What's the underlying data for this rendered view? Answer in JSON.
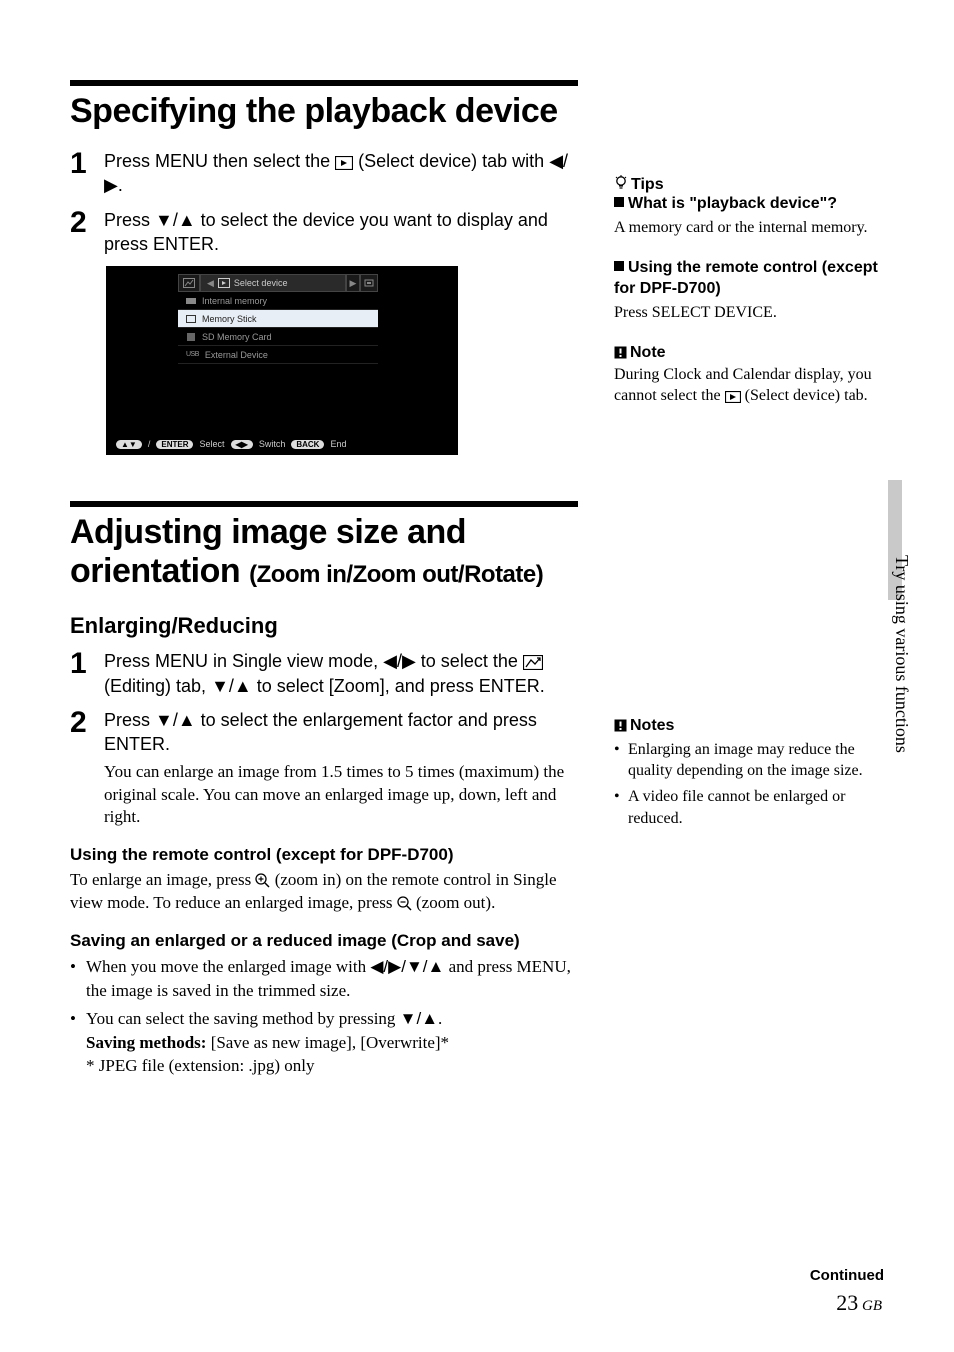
{
  "title1": "Specifying the playback device",
  "spec_steps": {
    "s1": {
      "num": "1",
      "text_a": "Press MENU then select the ",
      "text_b": " (Select device) tab with ",
      "arrows1": "B/b",
      "text_c": "."
    },
    "s2": {
      "num": "2",
      "text": "Press v/V to select the device you want to display and press ENTER."
    }
  },
  "screenshot": {
    "tab_label": "Select device",
    "items": [
      "Internal memory",
      "Memory Stick",
      "SD Memory Card",
      "External Device"
    ],
    "usb_prefix": "USB",
    "footer": {
      "enter": "ENTER",
      "select": "Select",
      "switch": "Switch",
      "back": "BACK",
      "end": "End"
    }
  },
  "title2_a": "Adjusting image size and orientation",
  "title2_b": "(Zoom in/Zoom out/Rotate)",
  "sect_enlarge": "Enlarging/Reducing",
  "enlarge_steps": {
    "s1": {
      "num": "1",
      "t1": "Press MENU in Single view mode, ",
      "ar1": "B/b",
      "t2": " to select the ",
      "t3": " (Editing) tab, ",
      "ar2": "v/V",
      "t4": " to select [Zoom], and press ENTER."
    },
    "s2": {
      "num": "2",
      "t1": "Press v/V to select the enlargement factor and press ENTER.",
      "extra": "You can enlarge an image from 1.5 times to 5 times (maximum) the original scale. You can move an enlarged image up, down, left and right."
    }
  },
  "remote_hd": "Using the remote control (except for DPF-D700)",
  "remote_body_a": "To enlarge an image, press ",
  "remote_body_b": " (zoom in) on the remote control in Single view mode. To reduce an enlarged image, press ",
  "remote_body_c": " (zoom out).",
  "crop_hd": "Saving an enlarged or a reduced image (Crop and save)",
  "crop_b1_a": "When you move the enlarged image with ",
  "crop_b1_ar": "B/b/v/V",
  "crop_b1_b": " and press MENU, the image is saved in the trimmed size.",
  "crop_b2_a": "You can select the saving method by pressing ",
  "crop_b2_ar": "v/V",
  "crop_b2_b": ".",
  "crop_methods_label": "Saving methods:",
  "crop_methods_vals": " [Save as new image],  [Overwrite]*",
  "crop_note": "* JPEG file (extension: .jpg) only",
  "side": {
    "tips_label": "Tips",
    "tips_q": "What is \"playback device\"?",
    "tips_ans": "A memory card or the internal memory.",
    "remote_hd": "Using the remote control (except for DPF-D700)",
    "remote_body": "Press SELECT DEVICE.",
    "note_label": "Note",
    "note_body_a": "During Clock and Calendar display, you cannot select the ",
    "note_body_b": " (Select device) tab.",
    "notes_label": "Notes",
    "notes_b1": "Enlarging an image may reduce the quality depending on the image size.",
    "notes_b2": "A video file cannot be enlarged or reduced."
  },
  "vtext": "Try using various functions",
  "continued": "Continued",
  "page_num": "23",
  "page_lang": "GB"
}
